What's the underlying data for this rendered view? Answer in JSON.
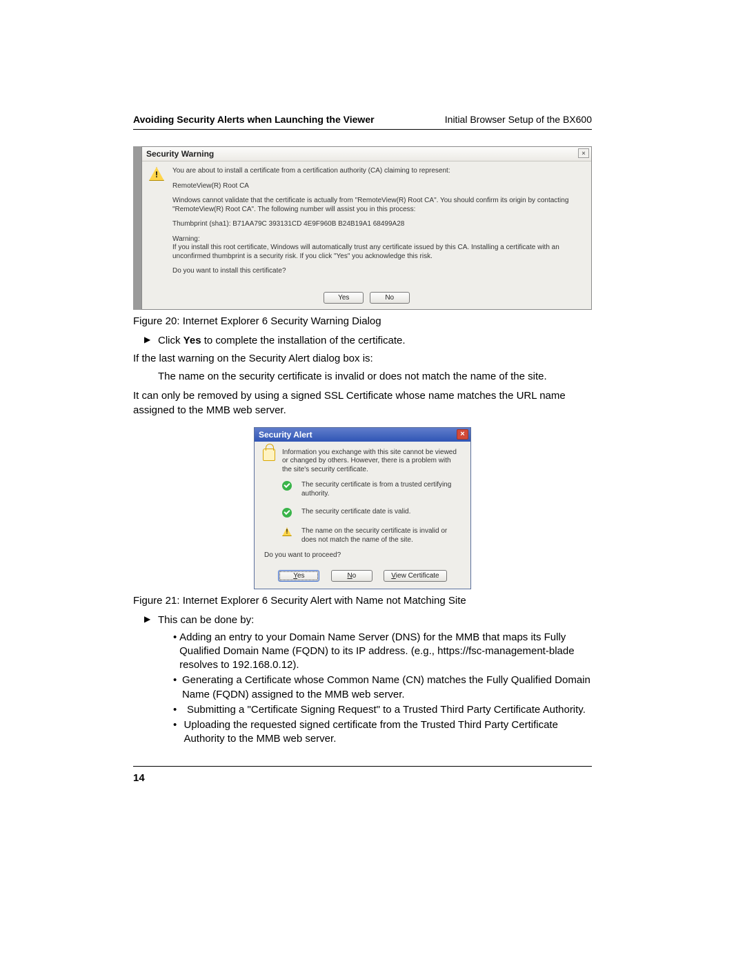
{
  "header": {
    "left": "Avoiding Security Alerts when Launching the Viewer",
    "right": "Initial Browser Setup of the BX600"
  },
  "fig20": {
    "title": "Security Warning",
    "close": "×",
    "p1": "You are about to install a certificate from a certification authority (CA) claiming to represent:",
    "p2": "RemoteView(R) Root CA",
    "p3": "Windows cannot validate that the certificate is actually from \"RemoteView(R) Root CA\". You should confirm its origin by contacting \"RemoteView(R) Root CA\". The following number will assist you in this process:",
    "p4": "Thumbprint (sha1): B71AA79C 393131CD 4E9F960B B24B19A1 68499A28",
    "p5a": "Warning:",
    "p5b": "If you install this root certificate, Windows will automatically trust any certificate issued by this CA. Installing a certificate with an unconfirmed thumbprint is a security risk. If you click \"Yes\" you acknowledge this risk.",
    "p6": "Do you want to install this certificate?",
    "yes": "Yes",
    "no": "No",
    "caption": "Figure 20: Internet Explorer 6 Security Warning Dialog"
  },
  "body": {
    "step_click_a": "Click ",
    "step_click_b": "Yes",
    "step_click_c": " to complete the installation of the certificate.",
    "if_last": "If the last warning on the Security Alert dialog box is:",
    "name_invalid": "The name on the security certificate is invalid or does not match the name of the site.",
    "removed": "It can only be removed by using a signed SSL Certificate whose name matches the URL name assigned to the MMB web server.",
    "this_can": "This can be done by:",
    "b1": "Adding an entry to your Domain Name Server (DNS) for the MMB that maps its Fully Qualified Domain Name (FQDN) to its IP address. (e.g., https://fsc-management-blade resolves to 192.168.0.12).",
    "b2": "Generating a Certificate whose Common Name (CN) matches the Fully Qualified Domain Name (FQDN) assigned to the MMB web server.",
    "b3": "Submitting a \"Certificate Signing Request\" to a Trusted Third Party Certificate Authority.",
    "b4": "Uploading the requested signed certificate from the Trusted Third Party Certificate Authority to the MMB web server."
  },
  "fig21": {
    "title": "Security Alert",
    "close": "×",
    "intro": "Information you exchange with this site cannot be viewed or changed by others. However, there is a problem with the site's security certificate.",
    "line1": "The security certificate is from a trusted certifying authority.",
    "line2": "The security certificate date is valid.",
    "line3": "The name on the security certificate is invalid or does not match the name of the site.",
    "proceed": "Do you want to proceed?",
    "yes_u": "Y",
    "yes_rest": "es",
    "no_u": "N",
    "no_rest": "o",
    "view_u": "V",
    "view_rest": "iew Certificate",
    "caption": "Figure 21: Internet Explorer 6 Security Alert with Name not Matching Site"
  },
  "page_number": "14"
}
